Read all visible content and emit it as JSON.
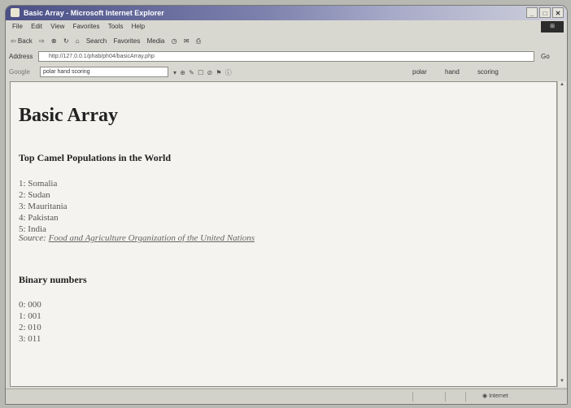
{
  "window": {
    "title": "Basic Array - Microsoft Internet Explorer"
  },
  "menu": [
    "File",
    "Edit",
    "View",
    "Favorites",
    "Tools",
    "Help"
  ],
  "toolbar": {
    "back": "⇦ Back",
    "search": "Search",
    "favorites": "Favorites",
    "media": "Media"
  },
  "address": {
    "label": "Address",
    "url": "http://127.0.0.1/phab/ph04/basicArray.php",
    "go": "Go"
  },
  "googlebar": {
    "label": "Google",
    "query": "polar hand scoring",
    "buttons": [
      "polar",
      "hand",
      "scoring"
    ]
  },
  "page": {
    "heading": "Basic Array",
    "camel_heading": "Top Camel Populations in the World",
    "camel_list": [
      "1: Somalia",
      "2: Sudan",
      "3: Mauritania",
      "4: Pakistan",
      "5: India"
    ],
    "source_label": "Source:",
    "source_link": "Food and Agriculture Organization of the United Nations",
    "binary_heading": "Binary numbers",
    "binary_list": [
      "0: 000",
      "1: 001",
      "2: 010",
      "3: 011"
    ]
  },
  "status": {
    "zone": "Internet"
  }
}
